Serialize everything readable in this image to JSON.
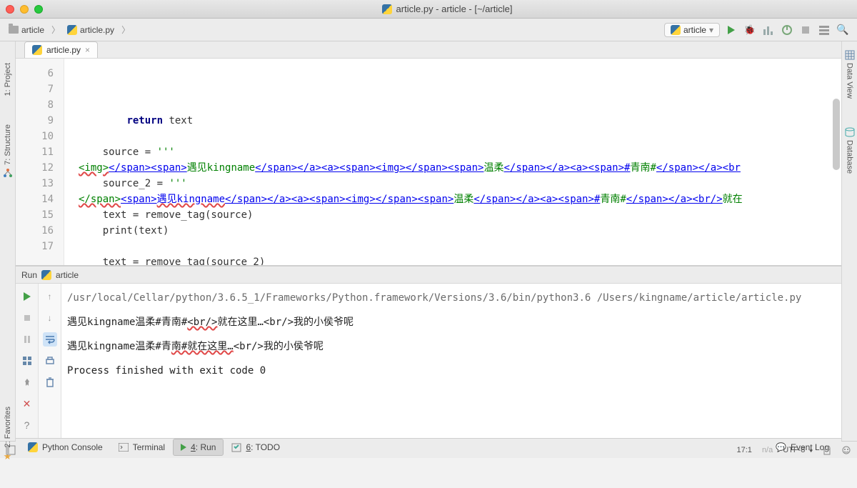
{
  "window": {
    "title": "article.py - article - [~/article]"
  },
  "breadcrumbs": {
    "project": "article",
    "file": "article.py"
  },
  "run_config": {
    "label": "article"
  },
  "left_rail": {
    "project": "1: Project",
    "structure": "7: Structure"
  },
  "right_rail": {
    "data_view": "Data View",
    "database": "Database"
  },
  "editor_tab": {
    "filename": "article.py"
  },
  "code": {
    "lines": [
      {
        "num": "6",
        "indent": "        ",
        "segs": [
          {
            "t": "return",
            "cls": "kw"
          },
          {
            "t": " text",
            "cls": ""
          }
        ]
      },
      {
        "num": "7",
        "indent": "",
        "segs": []
      },
      {
        "num": "8",
        "indent": "    ",
        "segs": [
          {
            "t": "source = ",
            "cls": ""
          },
          {
            "t": "'''",
            "cls": "str"
          }
        ]
      },
      {
        "num": "9",
        "indent": "",
        "segs": [
          {
            "t": "<img>",
            "cls": "str underline-red"
          },
          {
            "t": "</span><span>",
            "cls": "str lnk"
          },
          {
            "t": "遇见kingname",
            "cls": "str"
          },
          {
            "t": "</span></a><a><span><img></span><span>",
            "cls": "str lnk"
          },
          {
            "t": "温柔",
            "cls": "str"
          },
          {
            "t": "</span></a><a><span>#",
            "cls": "str lnk"
          },
          {
            "t": "青南#",
            "cls": "str"
          },
          {
            "t": "</span></a><br",
            "cls": "str lnk"
          }
        ]
      },
      {
        "num": "10",
        "indent": "    ",
        "segs": [
          {
            "t": "source_2 = ",
            "cls": ""
          },
          {
            "t": "'''",
            "cls": "str"
          }
        ]
      },
      {
        "num": "11",
        "indent": "",
        "segs": [
          {
            "t": "</span>",
            "cls": "str underline-red"
          },
          {
            "t": "<span>",
            "cls": "str lnk"
          },
          {
            "t": "遇见kingname",
            "cls": "str lnk underline-red"
          },
          {
            "t": "</span></a><a><span><img></span><span>",
            "cls": "str lnk"
          },
          {
            "t": "温柔",
            "cls": "str"
          },
          {
            "t": "</span></a><a><span>#",
            "cls": "str lnk"
          },
          {
            "t": "青南#",
            "cls": "str"
          },
          {
            "t": "</span></a><br/>",
            "cls": "str lnk"
          },
          {
            "t": "就在",
            "cls": "str"
          }
        ]
      },
      {
        "num": "12",
        "indent": "    ",
        "segs": [
          {
            "t": "text = remove_tag(source)",
            "cls": ""
          }
        ]
      },
      {
        "num": "13",
        "indent": "    ",
        "segs": [
          {
            "t": "print(text)",
            "cls": ""
          }
        ]
      },
      {
        "num": "14",
        "indent": "",
        "segs": []
      },
      {
        "num": "15",
        "indent": "    ",
        "segs": [
          {
            "t": "text = remove_tag(source_2)",
            "cls": ""
          }
        ]
      },
      {
        "num": "16",
        "indent": "    ",
        "segs": [
          {
            "t": "print(text)",
            "cls": ""
          }
        ]
      },
      {
        "num": "17",
        "indent": "    ",
        "segs": [],
        "hl": true,
        "cursor": true
      }
    ]
  },
  "run_panel": {
    "title_prefix": "Run",
    "title_config": "article"
  },
  "console": {
    "path": "/usr/local/Cellar/python/3.6.5_1/Frameworks/Python.framework/Versions/3.6/bin/python3.6 /Users/kingname/article/article.py",
    "out1_a": "遇见kingname温柔#青南#",
    "out1_b": "<br/>",
    "out1_c": "就在这里…<br/>我的小侯爷呢",
    "out2_a": "遇见kingname温柔#青",
    "out2_b": "南#就在这里…",
    "out2_c": "<br/>我的小侯爷呢",
    "exit": "Process finished with exit code 0"
  },
  "bottom_tabs": {
    "python_console": "Python Console",
    "terminal": "Terminal",
    "run": "4: Run",
    "todo": "6: TODO",
    "event_log": "Event Log"
  },
  "left_rail2": {
    "favorites": "2: Favorites"
  },
  "status": {
    "pos": "17:1",
    "na": "n/a",
    "encoding": "UTF-8"
  }
}
